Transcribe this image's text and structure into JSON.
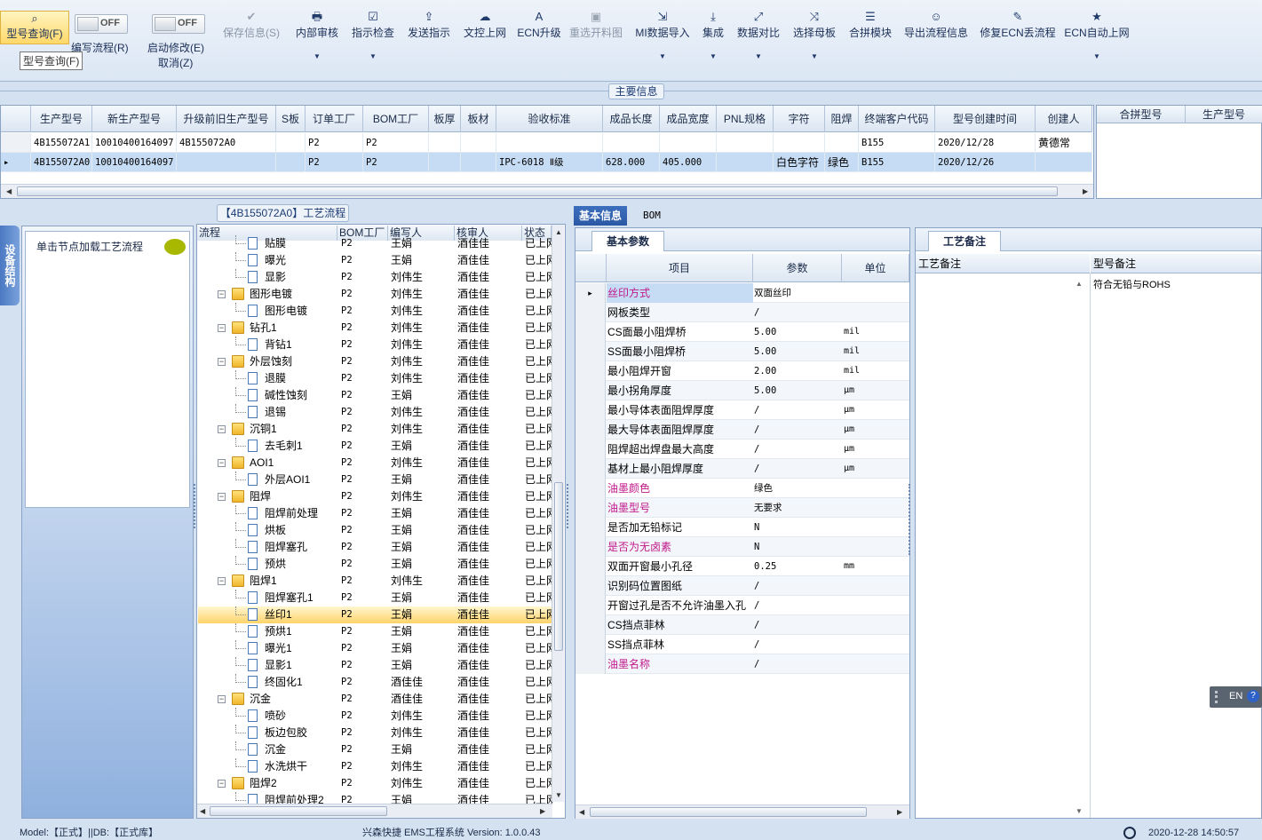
{
  "toolbar": {
    "query": "型号查询(F)",
    "query_tip": "型号查询(F)",
    "edit_flow": "编写流程(R)",
    "auto_modify": "启动修改(E)",
    "cancel": "取消(Z)",
    "toggle_off": "OFF",
    "buttons": [
      {
        "label": "保存信息(S)",
        "icon": "check-icon"
      },
      {
        "label": "内部审核",
        "icon": "printer-icon"
      },
      {
        "label": "指示检查",
        "icon": "checkbox-icon"
      },
      {
        "label": "发送指示",
        "icon": "upload-icon"
      },
      {
        "label": "文控上网",
        "icon": "cloud-upload-icon"
      },
      {
        "label": "ECN升级",
        "icon": "ecn-icon"
      },
      {
        "label": "重选开料图",
        "icon": "image-icon"
      },
      {
        "label": "MI数据导入",
        "icon": "import-icon"
      },
      {
        "label": "集成",
        "icon": "download-icon"
      },
      {
        "label": "数据对比",
        "icon": "compare-icon"
      },
      {
        "label": "选择母板",
        "icon": "shuffle-icon"
      },
      {
        "label": "合拼模块",
        "icon": "list-icon"
      },
      {
        "label": "导出流程信息",
        "icon": "smile-icon"
      },
      {
        "label": "修复ECN丢流程",
        "icon": "wrench-icon"
      },
      {
        "label": "ECN自动上网",
        "icon": "star-icon"
      }
    ]
  },
  "main_info": {
    "section_label": "主要信息",
    "columns": [
      "生产型号",
      "新生产型号",
      "升级前旧生产型号",
      "S板",
      "订单工厂",
      "BOM工厂",
      "板厚",
      "板材",
      "验收标准",
      "成品长度",
      "成品宽度",
      "PNL规格",
      "字符",
      "阻焊",
      "终端客户代码",
      "型号创建时间",
      "创建人"
    ],
    "rows": [
      [
        "4B155072A1",
        "10010400164097",
        "4B155072A0",
        "",
        "P2",
        "P2",
        "",
        "",
        "",
        "",
        "",
        "",
        "",
        "",
        "B155",
        "2020/12/28",
        "黄德常"
      ],
      [
        "4B155072A0",
        "10010400164097",
        "",
        "",
        "P2",
        "P2",
        "",
        "",
        "IPC-6018 Ⅱ级",
        "628.000",
        "405.000",
        "",
        "白色字符",
        "绿色",
        "B155",
        "2020/12/26",
        ""
      ]
    ],
    "side_columns": [
      "合拼型号",
      "生产型号"
    ]
  },
  "left_panel": {
    "tab": "设备结构",
    "hint": "单击节点加载工艺流程"
  },
  "flow": {
    "title": "【4B155072A0】工艺流程",
    "columns": [
      "流程",
      "BOM工厂",
      "编写人",
      "核审人",
      "状态"
    ],
    "rows": [
      {
        "name": "贴膜",
        "bom": "P2",
        "writer": "王娟",
        "reviewer": "酒佳佳",
        "status": "已上网",
        "level": 1
      },
      {
        "name": "曝光",
        "bom": "P2",
        "writer": "王娟",
        "reviewer": "酒佳佳",
        "status": "已上网",
        "level": 1
      },
      {
        "name": "显影",
        "bom": "P2",
        "writer": "刘伟生",
        "reviewer": "酒佳佳",
        "status": "已上网",
        "level": 1
      },
      {
        "name": "图形电镀",
        "bom": "P2",
        "writer": "刘伟生",
        "reviewer": "酒佳佳",
        "status": "已上网",
        "level": 0
      },
      {
        "name": "图形电镀",
        "bom": "P2",
        "writer": "刘伟生",
        "reviewer": "酒佳佳",
        "status": "已上网",
        "level": 1
      },
      {
        "name": "钻孔1",
        "bom": "P2",
        "writer": "刘伟生",
        "reviewer": "酒佳佳",
        "status": "已上网",
        "level": 0
      },
      {
        "name": "背钻1",
        "bom": "P2",
        "writer": "刘伟生",
        "reviewer": "酒佳佳",
        "status": "已上网",
        "level": 1
      },
      {
        "name": "外层蚀刻",
        "bom": "P2",
        "writer": "刘伟生",
        "reviewer": "酒佳佳",
        "status": "已上网",
        "level": 0
      },
      {
        "name": "退膜",
        "bom": "P2",
        "writer": "刘伟生",
        "reviewer": "酒佳佳",
        "status": "已上网",
        "level": 1
      },
      {
        "name": "碱性蚀刻",
        "bom": "P2",
        "writer": "王娟",
        "reviewer": "酒佳佳",
        "status": "已上网",
        "level": 1
      },
      {
        "name": "退锡",
        "bom": "P2",
        "writer": "刘伟生",
        "reviewer": "酒佳佳",
        "status": "已上网",
        "level": 1
      },
      {
        "name": "沉铜1",
        "bom": "P2",
        "writer": "刘伟生",
        "reviewer": "酒佳佳",
        "status": "已上网",
        "level": 0
      },
      {
        "name": "去毛刺1",
        "bom": "P2",
        "writer": "王娟",
        "reviewer": "酒佳佳",
        "status": "已上网",
        "level": 1
      },
      {
        "name": "AOI1",
        "bom": "P2",
        "writer": "刘伟生",
        "reviewer": "酒佳佳",
        "status": "已上网",
        "level": 0
      },
      {
        "name": "外层AOI1",
        "bom": "P2",
        "writer": "王娟",
        "reviewer": "酒佳佳",
        "status": "已上网",
        "level": 1
      },
      {
        "name": "阻焊",
        "bom": "P2",
        "writer": "刘伟生",
        "reviewer": "酒佳佳",
        "status": "已上网",
        "level": 0
      },
      {
        "name": "阻焊前处理",
        "bom": "P2",
        "writer": "王娟",
        "reviewer": "酒佳佳",
        "status": "已上网",
        "level": 1
      },
      {
        "name": "烘板",
        "bom": "P2",
        "writer": "王娟",
        "reviewer": "酒佳佳",
        "status": "已上网",
        "level": 1
      },
      {
        "name": "阻焊塞孔",
        "bom": "P2",
        "writer": "王娟",
        "reviewer": "酒佳佳",
        "status": "已上网",
        "level": 1
      },
      {
        "name": "预烘",
        "bom": "P2",
        "writer": "王娟",
        "reviewer": "酒佳佳",
        "status": "已上网",
        "level": 1
      },
      {
        "name": "阻焊1",
        "bom": "P2",
        "writer": "刘伟生",
        "reviewer": "酒佳佳",
        "status": "已上网",
        "level": 0
      },
      {
        "name": "阻焊塞孔1",
        "bom": "P2",
        "writer": "王娟",
        "reviewer": "酒佳佳",
        "status": "已上网",
        "level": 1
      },
      {
        "name": "丝印1",
        "bom": "P2",
        "writer": "王娟",
        "reviewer": "酒佳佳",
        "status": "已上网",
        "level": 1,
        "selected": true
      },
      {
        "name": "预烘1",
        "bom": "P2",
        "writer": "王娟",
        "reviewer": "酒佳佳",
        "status": "已上网",
        "level": 1
      },
      {
        "name": "曝光1",
        "bom": "P2",
        "writer": "王娟",
        "reviewer": "酒佳佳",
        "status": "已上网",
        "level": 1
      },
      {
        "name": "显影1",
        "bom": "P2",
        "writer": "王娟",
        "reviewer": "酒佳佳",
        "status": "已上网",
        "level": 1
      },
      {
        "name": "终固化1",
        "bom": "P2",
        "writer": "酒佳佳",
        "reviewer": "酒佳佳",
        "status": "已上网",
        "level": 1
      },
      {
        "name": "沉金",
        "bom": "P2",
        "writer": "酒佳佳",
        "reviewer": "酒佳佳",
        "status": "已上网",
        "level": 0
      },
      {
        "name": "喷砂",
        "bom": "P2",
        "writer": "刘伟生",
        "reviewer": "酒佳佳",
        "status": "已上网",
        "level": 1
      },
      {
        "name": "板边包胶",
        "bom": "P2",
        "writer": "刘伟生",
        "reviewer": "酒佳佳",
        "status": "已上网",
        "level": 1
      },
      {
        "name": "沉金",
        "bom": "P2",
        "writer": "王娟",
        "reviewer": "酒佳佳",
        "status": "已上网",
        "level": 1
      },
      {
        "name": "水洗烘干",
        "bom": "P2",
        "writer": "刘伟生",
        "reviewer": "酒佳佳",
        "status": "已上网",
        "level": 1
      },
      {
        "name": "阻焊2",
        "bom": "P2",
        "writer": "刘伟生",
        "reviewer": "酒佳佳",
        "status": "已上网",
        "level": 0
      },
      {
        "name": "阻焊前处理2",
        "bom": "P2",
        "writer": "王娟",
        "reviewer": "酒佳佳",
        "status": "已上网",
        "level": 1
      }
    ]
  },
  "detail": {
    "tabs": [
      "基本信息",
      "BOM"
    ],
    "subtab": "基本参数",
    "columns": [
      "项目",
      "参数",
      "单位"
    ],
    "rows": [
      {
        "k": "丝印方式",
        "v": "双面丝印",
        "u": "",
        "pink": true
      },
      {
        "k": "网板类型",
        "v": "/",
        "u": ""
      },
      {
        "k": "CS面最小阻焊桥",
        "v": "5.00",
        "u": "mil"
      },
      {
        "k": "SS面最小阻焊桥",
        "v": "5.00",
        "u": "mil"
      },
      {
        "k": "最小阻焊开窗",
        "v": "2.00",
        "u": "mil"
      },
      {
        "k": "最小拐角厚度",
        "v": "5.00",
        "u": "μm"
      },
      {
        "k": "最小导体表面阻焊厚度",
        "v": "/",
        "u": "μm"
      },
      {
        "k": "最大导体表面阻焊厚度",
        "v": "/",
        "u": "μm"
      },
      {
        "k": "阻焊超出焊盘最大高度",
        "v": "/",
        "u": "μm"
      },
      {
        "k": "基材上最小阻焊厚度",
        "v": "/",
        "u": "μm"
      },
      {
        "k": "油墨颜色",
        "v": "绿色",
        "u": "",
        "pink": true
      },
      {
        "k": "油墨型号",
        "v": "无要求",
        "u": "",
        "pink": true
      },
      {
        "k": "是否加无铅标记",
        "v": "N",
        "u": ""
      },
      {
        "k": "是否为无卤素",
        "v": "N",
        "u": "",
        "pink": true
      },
      {
        "k": "双面开窗最小孔径",
        "v": "0.25",
        "u": "mm"
      },
      {
        "k": "识别码位置图纸",
        "v": "/",
        "u": ""
      },
      {
        "k": "开窗过孔是否不允许油墨入孔",
        "v": "/",
        "u": ""
      },
      {
        "k": "CS挡点菲林",
        "v": "/",
        "u": ""
      },
      {
        "k": "SS挡点菲林",
        "v": "/",
        "u": ""
      },
      {
        "k": "油墨名称",
        "v": "/",
        "u": "",
        "pink": true
      }
    ]
  },
  "remarks": {
    "tab": "工艺备注",
    "col1": "工艺备注",
    "col2": "型号备注",
    "model_remark": "符合无铅与ROHS"
  },
  "lang": {
    "code": "EN"
  },
  "status": {
    "model": "Model:【正式】||DB:【正式库】",
    "app": "兴森快捷 EMS工程系统 Version: 1.0.0.43",
    "datetime": "2020-12-28 14:50:57"
  }
}
